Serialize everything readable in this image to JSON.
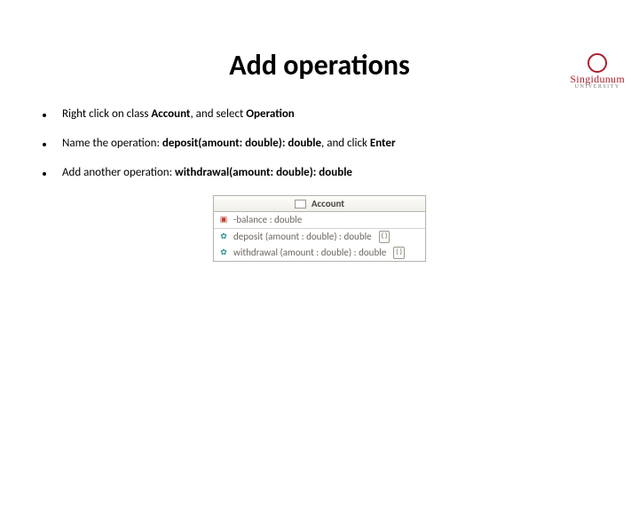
{
  "logo": {
    "main": "Singidunum",
    "sub": "UNIVERSITY"
  },
  "title": "Add operations",
  "bullets": [
    {
      "pre": "Right click on class ",
      "b1": "Account",
      "mid": ", and select ",
      "b2": "Operation",
      "post": ""
    },
    {
      "pre": "Name the operation: ",
      "b1": "deposit(amount: double): double",
      "mid": ", and click ",
      "b2": "Enter",
      "post": ""
    },
    {
      "pre": "Add another operation: ",
      "b1": "withdrawal(amount: double): double",
      "mid": "",
      "b2": "",
      "post": ""
    }
  ],
  "class_diagram": {
    "name": "Account",
    "attributes": [
      {
        "label": "-balance : double"
      }
    ],
    "operations": [
      {
        "label": "deposit (amount : double) : double",
        "paren": "( )"
      },
      {
        "label": "withdrawal (amount : double) : double",
        "paren": "( )"
      }
    ]
  }
}
